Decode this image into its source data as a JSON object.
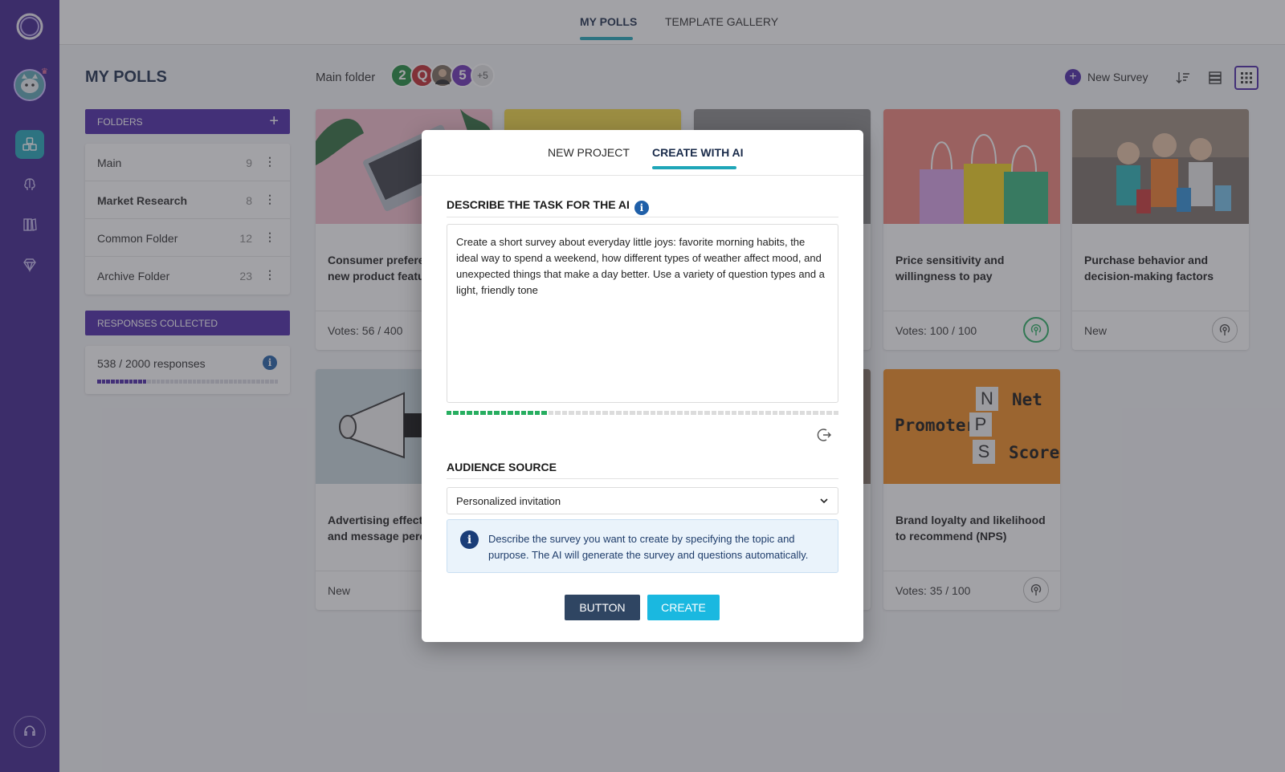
{
  "top_tabs": [
    "MY POLLS",
    "TEMPLATE GALLERY"
  ],
  "page_title": "MY POLLS",
  "folder_label": "Main folder",
  "collaborators": [
    {
      "text": "2",
      "color": "#1e8a3c"
    },
    {
      "text": "Q",
      "color": "#c0282d"
    },
    {
      "text": "",
      "color": "#7a6a5a"
    },
    {
      "text": "5",
      "color": "#6a2fb5"
    },
    {
      "text": "+5",
      "color": "#e4e4e4"
    }
  ],
  "new_survey_label": "New Survey",
  "folders_header": "FOLDERS",
  "folders": [
    {
      "name": "Main",
      "count": "9"
    },
    {
      "name": "Market Research",
      "count": "8"
    },
    {
      "name": "Common Folder",
      "count": "12"
    },
    {
      "name": "Archive Folder",
      "count": "23"
    }
  ],
  "responses_header": "RESPONSES COLLECTED",
  "responses_text": "538 / 2000 responses",
  "responses_progress": 0.27,
  "cards": [
    {
      "title": "Consumer preferences for new product features",
      "status": "Votes: 56 / 400"
    },
    {
      "title": "",
      "status": ""
    },
    {
      "title": "",
      "status": ""
    },
    {
      "title": "Price sensitivity and willingness to pay",
      "status": "Votes: 100 / 100"
    },
    {
      "title": "Purchase behavior and decision-making factors",
      "status": "New"
    },
    {
      "title": "Advertising effectiveness and message perception",
      "status": "New"
    },
    {
      "title": "Brand loyalty and likelihood to recommend (NPS)",
      "status": "Votes: 35 / 100"
    }
  ],
  "nps_image": {
    "promoter": "Promoter",
    "net": "Net",
    "score": "Score",
    "letters": [
      "N",
      "P",
      "S"
    ]
  },
  "modal": {
    "tabs": [
      "NEW PROJECT",
      "CREATE WITH AI"
    ],
    "task_title": "DESCRIBE THE TASK FOR THE AI",
    "task_text": "Create a short survey about everyday little joys: favorite morning habits, the ideal way to spend a weekend, how different types of weather affect mood, and unexpected things that make a day better. Use a variety of question types and a light, friendly tone",
    "task_progress": 0.26,
    "audience_title": "AUDIENCE SOURCE",
    "audience_value": "Personalized invitation",
    "hint": "Describe the survey you want to create by specifying the topic and purpose. The AI will generate the survey and questions automatically.",
    "btn_secondary": "BUTTON",
    "btn_primary": "CREATE"
  },
  "colors": {
    "sidebar": "#3d1f8c",
    "accent": "#1fa6b8",
    "primary": "#4a25a8",
    "create_button": "#1ab8e0"
  }
}
